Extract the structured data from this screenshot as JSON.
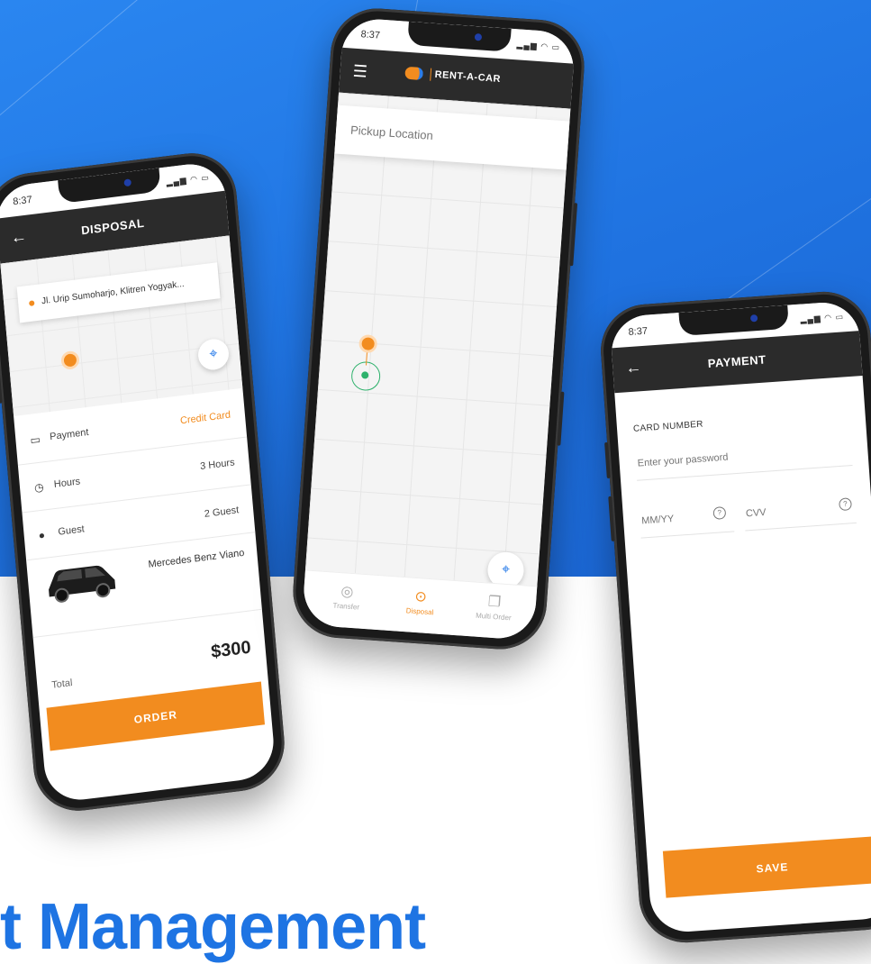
{
  "headline": "t Management",
  "colors": {
    "accent": "#f28c1f",
    "brand_blue": "#1e74e3",
    "appbar": "#2b2b2b"
  },
  "status_time": "8:37",
  "disposal_screen": {
    "title": "DISPOSAL",
    "address": "Jl. Urip Sumoharjo, Klitren Yogyak...",
    "rows": [
      {
        "icon": "credit-card-icon",
        "label": "Payment",
        "value": "Credit Card"
      },
      {
        "icon": "clock-icon",
        "label": "Hours",
        "value": "3 Hours"
      },
      {
        "icon": "user-icon",
        "label": "Guest",
        "value": "2 Guest"
      }
    ],
    "car_name": "Mercedes Benz Viano",
    "total_label": "Total",
    "total_value": "$300",
    "order_label": "ORDER"
  },
  "map_screen": {
    "logo_text": "RENT-A-CAR",
    "pickup_placeholder": "Pickup Location",
    "tabs": [
      {
        "icon": "transfer-icon",
        "label": "Transfer"
      },
      {
        "icon": "location-pin-icon",
        "label": "Disposal",
        "active": true
      },
      {
        "icon": "multi-order-icon",
        "label": "Multi Order"
      }
    ]
  },
  "payment_screen": {
    "title": "PAYMENT",
    "card_number_label": "CARD NUMBER",
    "card_placeholder": "Enter your password",
    "expiry_placeholder": "MM/YY",
    "cvv_placeholder": "CVV",
    "save_label": "SAVE"
  }
}
